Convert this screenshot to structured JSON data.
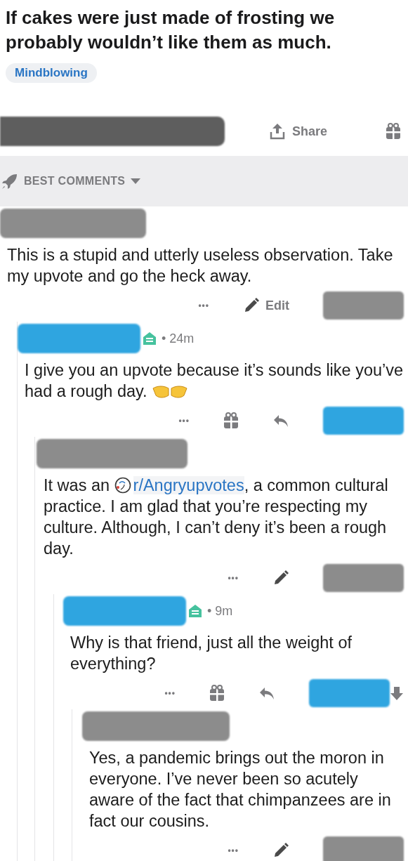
{
  "post": {
    "title": "If cakes were just made of frosting we probably wouldn’t like them as much.",
    "flair": "Mindblowing"
  },
  "action_bar": {
    "redaction": {
      "color": "#5e5e5e"
    },
    "share_label": "Share"
  },
  "sort": {
    "label": "BEST COMMENTS"
  },
  "comments": [
    {
      "author": {
        "color": "#8c8c8c"
      },
      "body": [
        {
          "kind": "text",
          "text": "This is a stupid and utterly useless observation. Take my upvote and go the heck away."
        }
      ],
      "actions": [
        {
          "kind": "more",
          "label": "•••"
        },
        {
          "kind": "edit",
          "label": "Edit"
        },
        {
          "kind": "redacted",
          "color": "#8c8c8c"
        }
      ],
      "children": [
        {
          "author": {
            "color": "#2fa5e0"
          },
          "badge": true,
          "time": "• 24m",
          "body": [
            {
              "kind": "text",
              "text": "I give you an upvote because it’s sounds like you’ve had a rough day. "
            },
            {
              "kind": "emoji"
            }
          ],
          "actions": [
            {
              "kind": "more",
              "label": "•••"
            },
            {
              "kind": "gift"
            },
            {
              "kind": "reply"
            },
            {
              "kind": "redacted",
              "color": "#2fa5e0"
            }
          ],
          "children": [
            {
              "author": {
                "color": "#8c8c8c"
              },
              "body": [
                {
                  "kind": "text",
                  "text": "It was an "
                },
                {
                  "kind": "subreddit_link",
                  "text": "r/Angryupvotes"
                },
                {
                  "kind": "text",
                  "text": ", a common cultural practice. I am glad that you’re respecting my culture. Although, I can’t deny it’s been a rough day."
                }
              ],
              "actions": [
                {
                  "kind": "more",
                  "label": "•••"
                },
                {
                  "kind": "edit"
                },
                {
                  "kind": "redacted",
                  "color": "#8c8c8c"
                }
              ],
              "children": [
                {
                  "author": {
                    "color": "#2fa5e0"
                  },
                  "badge": true,
                  "time": "• 9m",
                  "body": [
                    {
                      "kind": "text",
                      "text": "Why is that friend, just all the weight of everything?"
                    }
                  ],
                  "actions": [
                    {
                      "kind": "more",
                      "label": "•••"
                    },
                    {
                      "kind": "gift"
                    },
                    {
                      "kind": "reply"
                    },
                    {
                      "kind": "redacted",
                      "color": "#2fa5e0"
                    },
                    {
                      "kind": "downvote"
                    }
                  ],
                  "children": [
                    {
                      "author": {
                        "color": "#8c8c8c"
                      },
                      "body": [
                        {
                          "kind": "text",
                          "text": "Yes, a pandemic brings out the moron in everyone. I’ve never been so acutely aware of the fact that chimpanzees are in fact our cousins."
                        }
                      ],
                      "actions": [
                        {
                          "kind": "more",
                          "label": "•••"
                        },
                        {
                          "kind": "edit"
                        },
                        {
                          "kind": "redacted",
                          "color": "#8c8c8c"
                        }
                      ]
                    }
                  ]
                }
              ]
            }
          ]
        }
      ]
    }
  ]
}
